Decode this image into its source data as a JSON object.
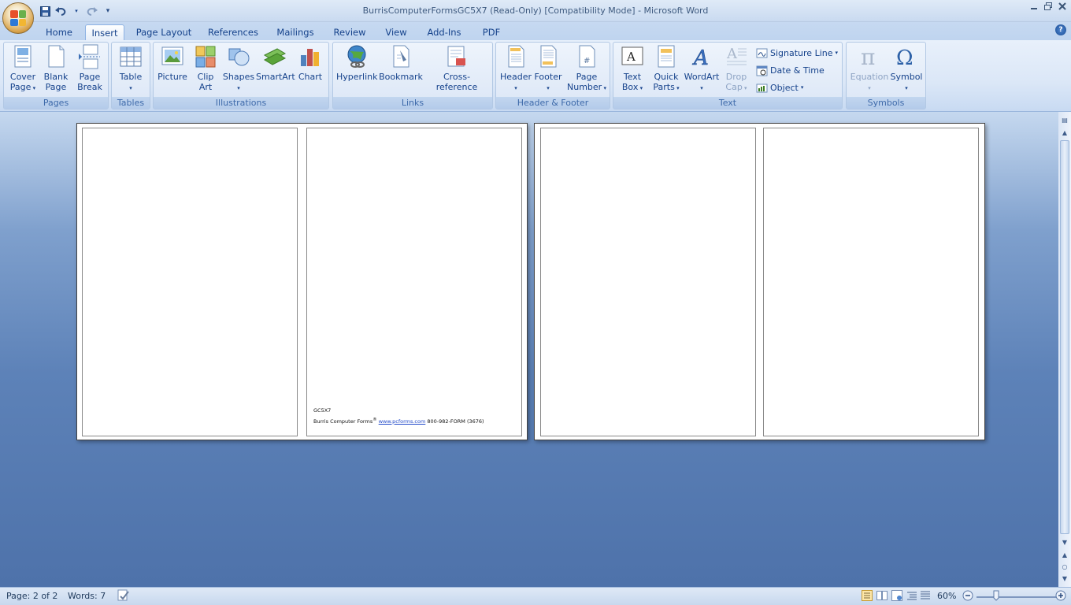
{
  "window": {
    "title": "BurrisComputerFormsGC5X7 (Read-Only) [Compatibility Mode] - Microsoft Word",
    "controls": [
      "minimize-icon",
      "restore-icon",
      "close-icon"
    ]
  },
  "tabs": [
    "Home",
    "Insert",
    "Page Layout",
    "References",
    "Mailings",
    "Review",
    "View",
    "Add-Ins",
    "PDF"
  ],
  "active_tab": "Insert",
  "ribbon": {
    "groups": {
      "pages": "Pages",
      "tables": "Tables",
      "illustrations": "Illustrations",
      "links": "Links",
      "header_footer": "Header & Footer",
      "text": "Text",
      "symbols": "Symbols"
    },
    "buttons": {
      "cover_page": [
        "Cover",
        "Page"
      ],
      "blank_page": [
        "Blank",
        "Page"
      ],
      "page_break": [
        "Page",
        "Break"
      ],
      "table": [
        "Table",
        ""
      ],
      "picture": [
        "Picture",
        ""
      ],
      "clip_art": [
        "Clip",
        "Art"
      ],
      "shapes": [
        "Shapes",
        ""
      ],
      "smartart": [
        "SmartArt",
        ""
      ],
      "chart": [
        "Chart",
        ""
      ],
      "hyperlink": [
        "Hyperlink",
        ""
      ],
      "bookmark": [
        "Bookmark",
        ""
      ],
      "cross_reference": [
        "Cross-reference",
        ""
      ],
      "header": [
        "Header",
        ""
      ],
      "footer": [
        "Footer",
        ""
      ],
      "page_number": [
        "Page",
        "Number"
      ],
      "text_box": [
        "Text",
        "Box"
      ],
      "quick_parts": [
        "Quick",
        "Parts"
      ],
      "wordart": [
        "WordArt",
        ""
      ],
      "drop_cap": [
        "Drop",
        "Cap"
      ],
      "equation": [
        "Equation",
        ""
      ],
      "symbol": [
        "Symbol",
        ""
      ]
    },
    "small_buttons": {
      "signature_line": "Signature Line",
      "date_time": "Date & Time",
      "object": "Object"
    }
  },
  "document": {
    "footer_line1": "GC5X7",
    "footer_line2_prefix": "Burris Computer Forms",
    "footer_link": "www.pcforms.com",
    "footer_line2_suffix": "800-982-FORM (3676)"
  },
  "status": {
    "page": "Page: 2 of 2",
    "words": "Words: 7",
    "zoom": "60%"
  },
  "colors": {
    "ribbon_bg": "#dbe7f7",
    "doc_bg": "#5d82b8",
    "link": "#2149c9"
  }
}
